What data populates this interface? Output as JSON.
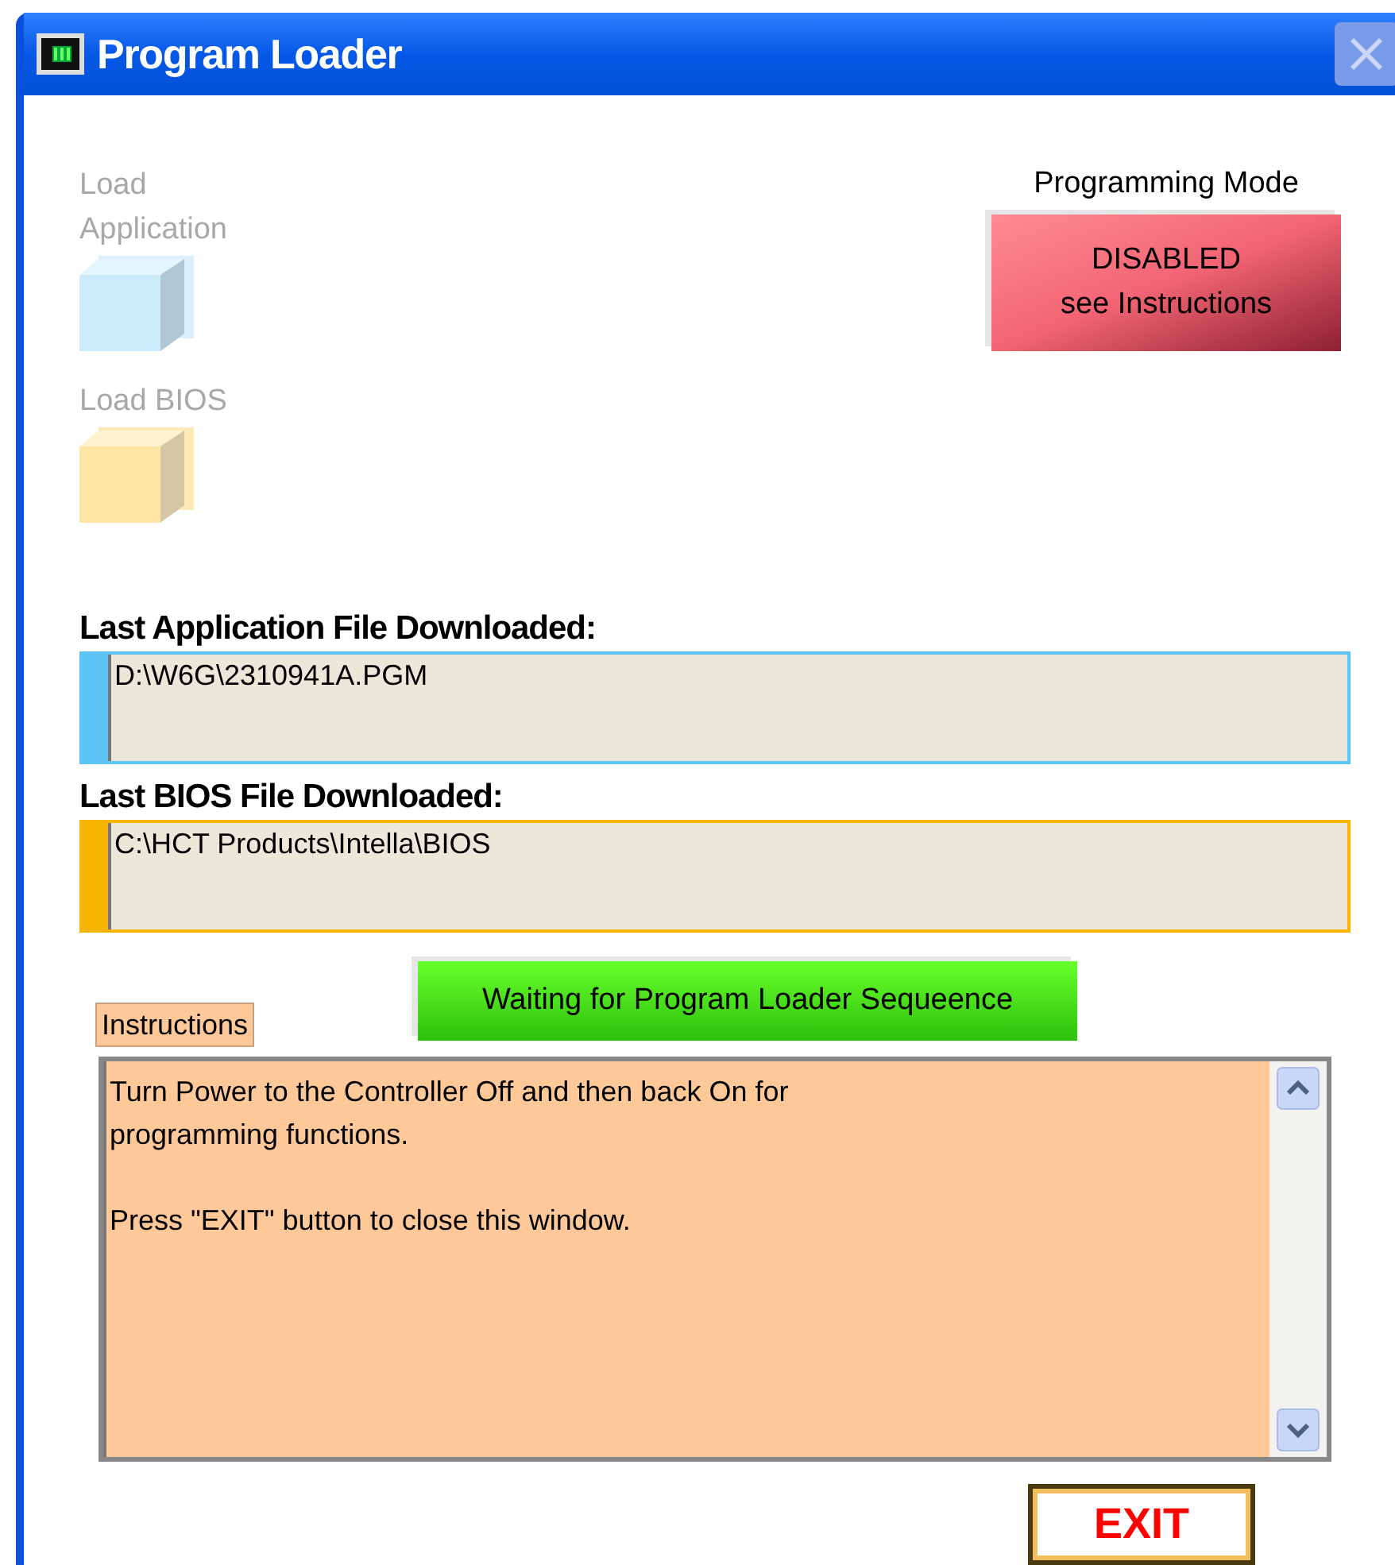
{
  "window": {
    "title": "Program Loader",
    "close_disabled": true
  },
  "loaders": [
    {
      "label": "Load Application",
      "disabled": true,
      "kind": "application"
    },
    {
      "label": "Load BIOS",
      "disabled": true,
      "kind": "bios"
    }
  ],
  "programming_mode": {
    "label": "Programming Mode",
    "status": "DISABLED\nsee Instructions",
    "enabled": false
  },
  "files": [
    {
      "label": "Last Application File Downloaded:",
      "value": "D:\\W6G\\2310941A.PGM",
      "kind": "application"
    },
    {
      "label": "Last BIOS File Downloaded:",
      "value": "C:\\HCT Products\\Intella\\BIOS",
      "kind": "bios"
    }
  ],
  "sequence_status": "Waiting for Program Loader Sequeence",
  "instructions": {
    "label": "Instructions",
    "paragraphs": [
      "Turn Power to the Controller Off and then back On for\nprogramming functions.",
      "Press \"EXIT\"  button to close this window."
    ]
  },
  "exit_button": "EXIT"
}
